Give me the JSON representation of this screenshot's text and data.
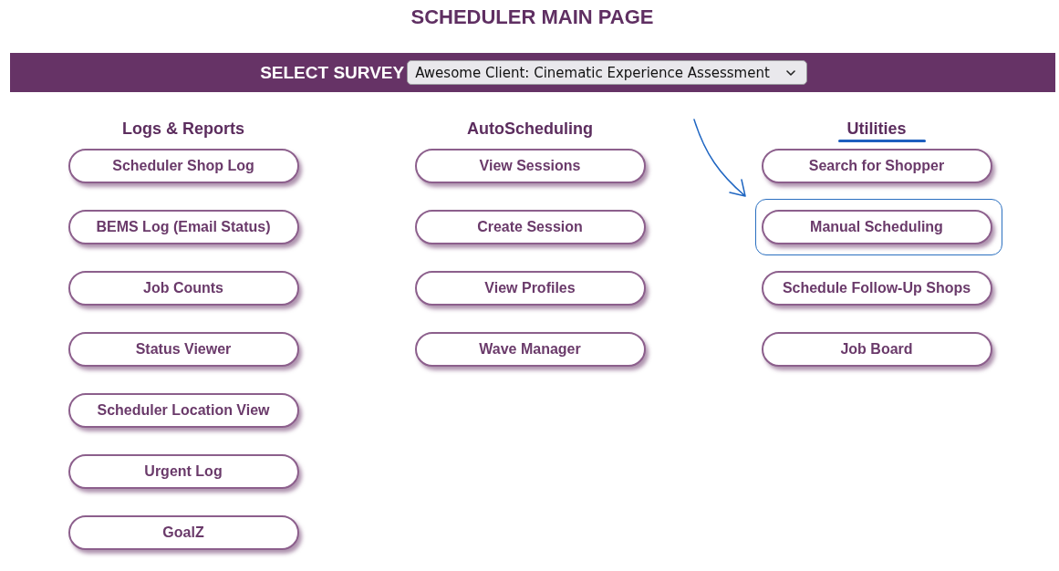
{
  "page": {
    "title": "SCHEDULER MAIN PAGE"
  },
  "survey_bar": {
    "label": "SELECT SURVEY",
    "dropdown": {
      "value": "Awesome Client: Cinematic Experience Assessment"
    }
  },
  "sections": [
    {
      "heading": "Logs & Reports",
      "underlined": false,
      "buttons": [
        {
          "label": "Scheduler Shop Log",
          "highlighted": false
        },
        {
          "label": "BEMS Log (Email Status)",
          "highlighted": false
        },
        {
          "label": "Job Counts",
          "highlighted": false
        },
        {
          "label": "Status Viewer",
          "highlighted": false
        },
        {
          "label": "Scheduler Location View",
          "highlighted": false
        },
        {
          "label": "Urgent Log",
          "highlighted": false
        },
        {
          "label": "GoalZ",
          "highlighted": false
        }
      ]
    },
    {
      "heading": "AutoScheduling",
      "underlined": false,
      "buttons": [
        {
          "label": "View Sessions",
          "highlighted": false
        },
        {
          "label": "Create Session",
          "highlighted": false
        },
        {
          "label": "View Profiles",
          "highlighted": false
        },
        {
          "label": "Wave Manager",
          "highlighted": false
        }
      ]
    },
    {
      "heading": "Utilities",
      "underlined": true,
      "buttons": [
        {
          "label": "Search for Shopper",
          "highlighted": false
        },
        {
          "label": "Manual Scheduling",
          "highlighted": true
        },
        {
          "label": "Schedule Follow-Up Shops",
          "highlighted": false
        },
        {
          "label": "Job Board",
          "highlighted": false
        }
      ]
    }
  ]
}
